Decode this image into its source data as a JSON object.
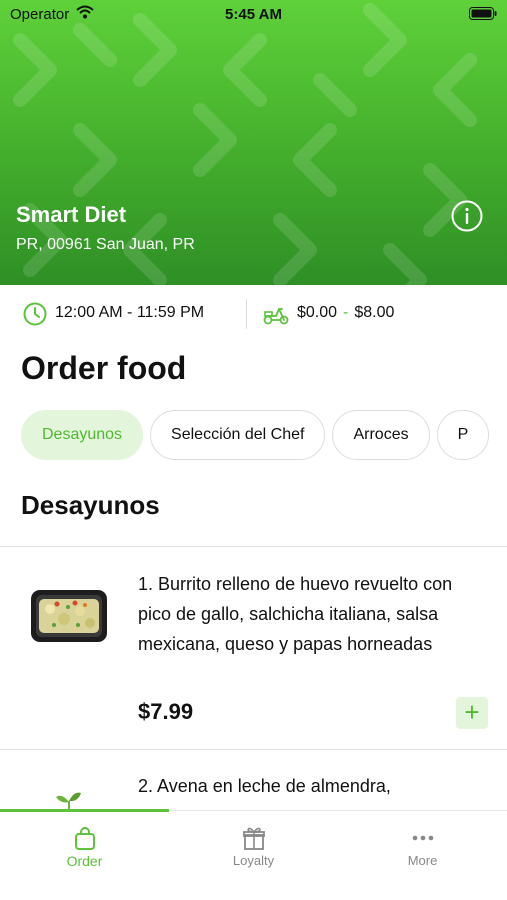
{
  "status_bar": {
    "carrier": "Operator",
    "time": "5:45 AM"
  },
  "store": {
    "name": "Smart Diet",
    "address": "PR, 00961 San Juan, PR"
  },
  "meta": {
    "hours": "12:00 AM - 11:59 PM",
    "fee_min": "$0.00",
    "fee_sep": "-",
    "fee_max": "$8.00"
  },
  "page_title": "Order food",
  "categories": [
    {
      "label": "Desayunos",
      "active": true
    },
    {
      "label": "Selección del Chef",
      "active": false
    },
    {
      "label": "Arroces",
      "active": false
    },
    {
      "label": "P",
      "active": false
    }
  ],
  "section": {
    "title": "Desayunos"
  },
  "items": [
    {
      "title": "1. Burrito relleno de huevo revuelto con pico de gallo, salchicha italiana, salsa mexicana, queso y papas horneadas",
      "price": "$7.99",
      "add_label": "+"
    },
    {
      "title": "2. Avena en leche de almendra,",
      "price": ""
    }
  ],
  "tabs": [
    {
      "label": "Order",
      "icon": "shopping-bag-icon",
      "active": true
    },
    {
      "label": "Loyalty",
      "icon": "gift-icon",
      "active": false
    },
    {
      "label": "More",
      "icon": "more-dots-icon",
      "active": false
    }
  ],
  "colors": {
    "accent": "#5cc33b",
    "accent_light": "#e3f6dc",
    "hero_green": "#48b42e"
  }
}
